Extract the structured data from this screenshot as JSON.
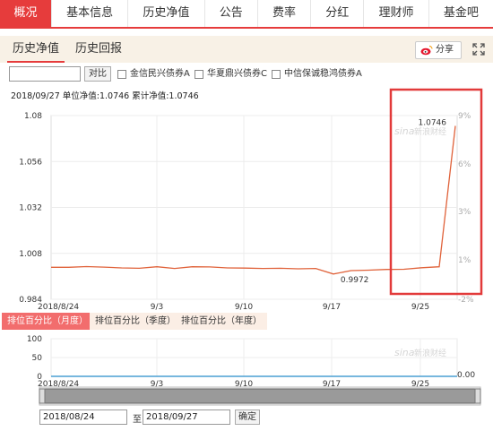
{
  "top_tabs": [
    "概况",
    "基本信息",
    "历史净值",
    "公告",
    "费率",
    "分红",
    "理财师",
    "基金吧"
  ],
  "sub_tabs": [
    "历史净值",
    "历史回报"
  ],
  "share_label": "分享",
  "compare": {
    "input_value": "",
    "button": "对比",
    "funds": [
      "金信民兴债券A",
      "华夏鼎兴债券C",
      "中信保诚稳鸿债券A"
    ]
  },
  "nav_info": "2018/09/27 单位净值:1.0746 累计净值:1.0746",
  "watermark": "新浪财经",
  "watermark_brand": "sina",
  "rank_tabs": [
    "排位百分比（月度）",
    "排位百分比（季度）",
    "排位百分比（年度）"
  ],
  "range": {
    "start": "2018/08/24",
    "to_label": "至",
    "end": "2018/09/27",
    "confirm": "确定"
  },
  "chart_data": [
    {
      "type": "line",
      "title": "",
      "x_tick_labels": [
        "2018/8/24",
        "9/3",
        "9/10",
        "9/17",
        "9/25"
      ],
      "y_ticks_left": [
        "1.08",
        "1.056",
        "1.032",
        "1.008",
        "0.984"
      ],
      "y_ticks_right": [
        "9%",
        "6%",
        "3%",
        "1%",
        "-2%"
      ],
      "ylim": [
        0.984,
        1.08
      ],
      "grid": true,
      "series": [
        {
          "color": "#e0623a",
          "x": [
            "2018/8/24",
            "8/27",
            "8/28",
            "8/29",
            "8/30",
            "8/31",
            "9/3",
            "9/4",
            "9/5",
            "9/6",
            "9/7",
            "9/10",
            "9/11",
            "9/12",
            "9/13",
            "9/14",
            "9/17",
            "9/18",
            "9/19",
            "9/20",
            "9/21",
            "9/25",
            "9/26",
            "9/27"
          ],
          "values": [
            1.0007,
            1.0007,
            1.0011,
            1.0008,
            1.0004,
            1.0002,
            1.001,
            1.0001,
            1.001,
            1.0009,
            1.0004,
            1.0003,
            1.0001,
            1.0002,
            0.9999,
            1.0001,
            0.9972,
            0.999,
            0.9992,
            0.9996,
            0.9997,
            1.0005,
            1.001,
            1.0746
          ]
        }
      ],
      "data_labels": [
        {
          "text": "0.9972",
          "x": "9/17",
          "y": 0.9972
        },
        {
          "text": "1.0746",
          "x": "9/27",
          "y": 1.0746
        }
      ],
      "highlight_box_color": "#e23a3a"
    },
    {
      "type": "line",
      "y_ticks": [
        "100",
        "50",
        "0"
      ],
      "ylim": [
        0,
        100
      ],
      "x_tick_labels": [
        "2018/8/24",
        "9/3",
        "9/10",
        "9/17",
        "9/25"
      ],
      "series": [
        {
          "color": "#4a9fd4",
          "values": [
            0,
            0
          ]
        }
      ],
      "end_label": "0.00"
    }
  ]
}
